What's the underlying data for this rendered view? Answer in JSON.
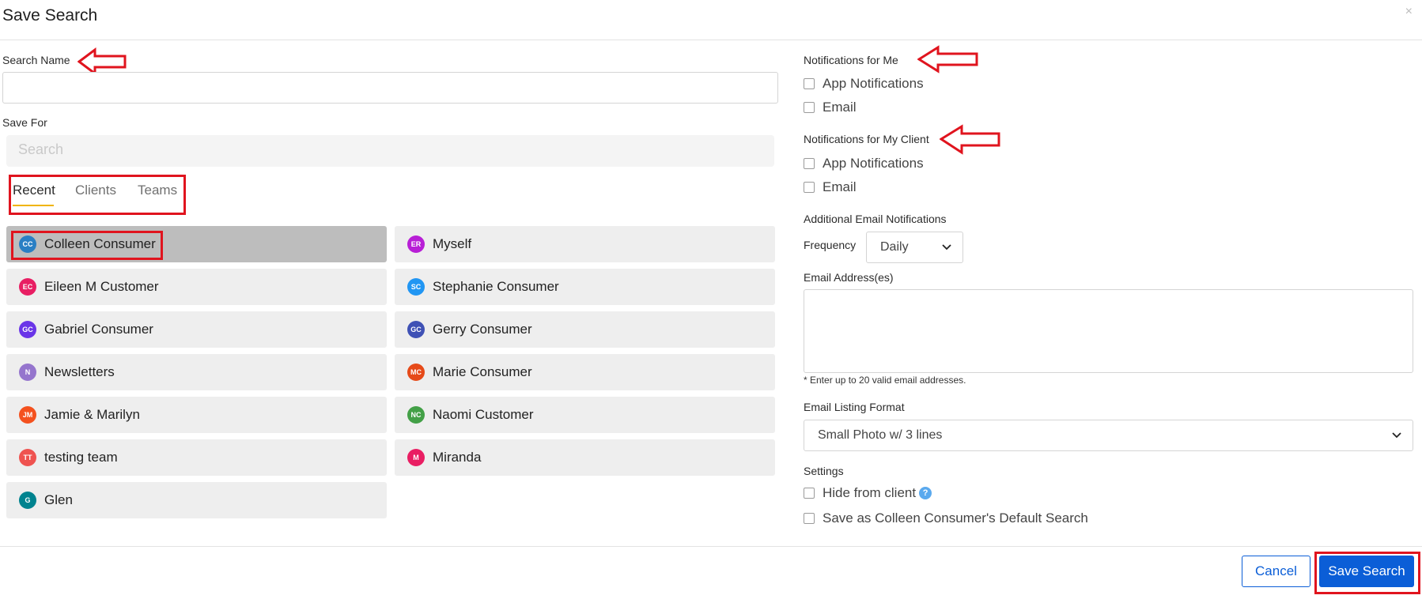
{
  "dialog": {
    "title": "Save Search",
    "close_symbol": "×"
  },
  "left": {
    "search_name_label": "Search Name",
    "search_name_value": "",
    "save_for_label": "Save For",
    "save_for_placeholder": "Search",
    "tabs": [
      "Recent",
      "Clients",
      "Teams"
    ],
    "active_tab": "Recent",
    "recipients": [
      {
        "initials": "CC",
        "name": "Colleen Consumer",
        "color": "#2a7fc4",
        "selected": true
      },
      {
        "initials": "ER",
        "name": "Myself",
        "color": "#b81fd6"
      },
      {
        "initials": "EC",
        "name": "Eileen M Customer",
        "color": "#e81e63"
      },
      {
        "initials": "SC",
        "name": "Stephanie Consumer",
        "color": "#2196f3"
      },
      {
        "initials": "GC",
        "name": "Gabriel Consumer",
        "color": "#6a35e8"
      },
      {
        "initials": "GC",
        "name": "Gerry Consumer",
        "color": "#3f51b5"
      },
      {
        "initials": "N",
        "name": "Newsletters",
        "color": "#9575cd"
      },
      {
        "initials": "MC",
        "name": "Marie Consumer",
        "color": "#e64a19"
      },
      {
        "initials": "JM",
        "name": "Jamie & Marilyn",
        "color": "#f4511e"
      },
      {
        "initials": "NC",
        "name": "Naomi Customer",
        "color": "#43a047"
      },
      {
        "initials": "TT",
        "name": "testing team",
        "color": "#ef5350"
      },
      {
        "initials": "M",
        "name": "Miranda",
        "color": "#e91e63"
      },
      {
        "initials": "G",
        "name": "Glen",
        "color": "#00838f"
      }
    ]
  },
  "right": {
    "notif_me_label": "Notifications for Me",
    "notif_me_options": [
      "App Notifications",
      "Email"
    ],
    "notif_client_label": "Notifications for My Client",
    "notif_client_options": [
      "App Notifications",
      "Email"
    ],
    "additional_label": "Additional Email Notifications",
    "frequency_label": "Frequency",
    "frequency_value": "Daily",
    "email_addresses_label": "Email Address(es)",
    "email_addresses_value": "",
    "email_hint": "* Enter up to 20 valid email addresses.",
    "listing_format_label": "Email Listing Format",
    "listing_format_value": "Small Photo w/ 3 lines",
    "settings_label": "Settings",
    "hide_from_client_label": "Hide from client",
    "help_symbol": "?",
    "default_search_label": "Save as Colleen Consumer's Default Search"
  },
  "footer": {
    "cancel_label": "Cancel",
    "save_label": "Save Search"
  },
  "colors": {
    "annotation_red": "#e0141e",
    "primary": "#0b5ed7",
    "tab_underline": "#f0b400"
  }
}
